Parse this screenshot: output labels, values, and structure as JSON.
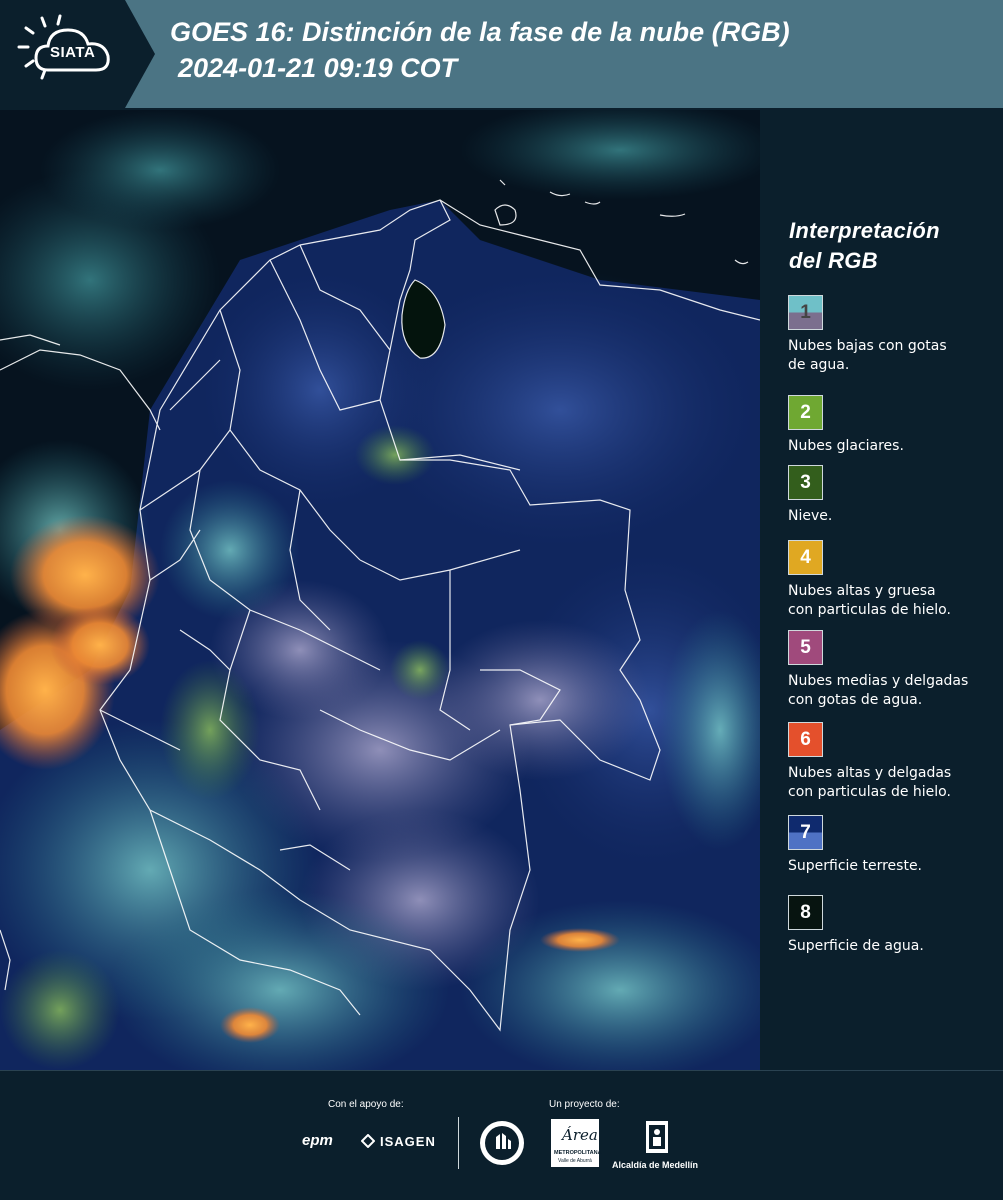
{
  "header": {
    "logo_text": "SIATA",
    "title_line1": "GOES 16: Distinción de la fase de la nube (RGB)",
    "title_line2": "2024-01-21 09:19 COT"
  },
  "legend": {
    "title_line1": "Interpretación",
    "title_line2": "del RGB",
    "items": [
      {
        "number": "1",
        "top_color": "#6fc0c8",
        "bottom_color": "#7b6f8e",
        "label_line1": "Nubes bajas con gotas",
        "label_line2": "de agua."
      },
      {
        "number": "2",
        "top_color": "#6fa832",
        "bottom_color": "#6fa832",
        "label_line1": "Nubes glaciares.",
        "label_line2": ""
      },
      {
        "number": "3",
        "top_color": "#335e1c",
        "bottom_color": "#335e1c",
        "label_line1": "Nieve.",
        "label_line2": ""
      },
      {
        "number": "4",
        "top_color": "#e0a822",
        "bottom_color": "#e0a822",
        "label_line1": "Nubes altas y gruesa",
        "label_line2": "con particulas de hielo."
      },
      {
        "number": "5",
        "top_color": "#a04a7c",
        "bottom_color": "#a04a7c",
        "label_line1": "Nubes medias y delgadas",
        "label_line2": "con gotas de agua."
      },
      {
        "number": "6",
        "top_color": "#e4502c",
        "bottom_color": "#e4502c",
        "label_line1": "Nubes altas y delgadas",
        "label_line2": "con particulas de hielo."
      },
      {
        "number": "7",
        "top_color": "#0f2a6e",
        "bottom_color": "#4f72c4",
        "label_line1": "Superficie terreste.",
        "label_line2": ""
      },
      {
        "number": "8",
        "top_color": "#071410",
        "bottom_color": "#071410",
        "label_line1": "Superficie de agua.",
        "label_line2": ""
      }
    ]
  },
  "footer": {
    "support_label": "Con el apoyo de:",
    "project_label": "Un proyecto de:",
    "sponsor1": "epm",
    "sponsor2": "ISAGEN",
    "partner1_line1": "METROPOLITANA",
    "partner1_line2": "Valle de Aburrá",
    "partner1_script": "Área",
    "partner2": "Alcaldía de Medellín"
  }
}
